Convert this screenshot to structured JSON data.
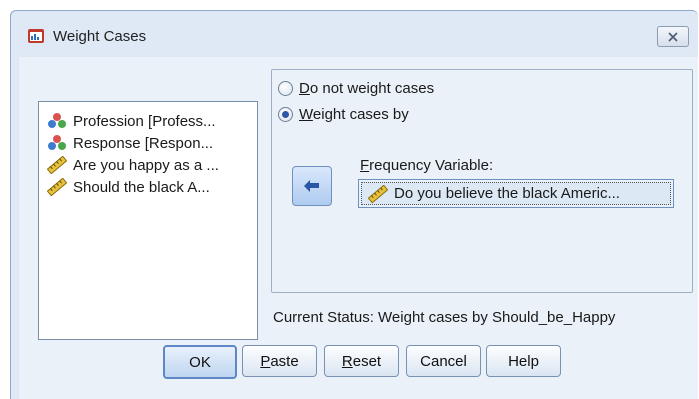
{
  "window": {
    "title": "Weight Cases"
  },
  "variables": [
    {
      "label": "Profession [Profess...",
      "icon": "nominal-variable-icon"
    },
    {
      "label": "Response [Respon...",
      "icon": "nominal-variable-icon"
    },
    {
      "label": "Are you happy as a ...",
      "icon": "scale-variable-icon"
    },
    {
      "label": "Should the black A...",
      "icon": "scale-variable-icon"
    }
  ],
  "options": {
    "no_weight": {
      "prefix": "",
      "accel": "D",
      "rest": "o not weight cases",
      "selected": false
    },
    "weight_by": {
      "prefix": "",
      "accel": "W",
      "rest": "eight cases by",
      "selected": true
    }
  },
  "frequency": {
    "label_accel": "F",
    "label_rest": "requency Variable:",
    "value": "Do you believe the black Americ...",
    "icon": "scale-variable-icon"
  },
  "status": "Current Status: Weight cases by Should_be_Happy",
  "buttons": {
    "ok": "OK",
    "paste_accel": "P",
    "paste_rest": "aste",
    "reset_accel": "R",
    "reset_rest": "eset",
    "cancel": "Cancel",
    "help": "Help"
  },
  "colors": {
    "window_bg": "#eaf1f9",
    "accent": "#2d56a8"
  }
}
